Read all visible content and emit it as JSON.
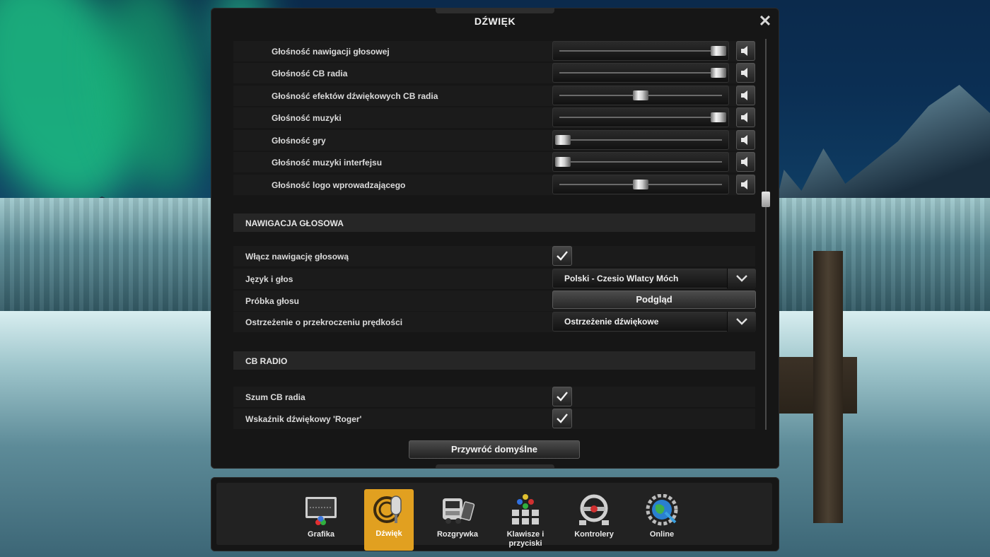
{
  "window": {
    "title": "DŹWIĘK",
    "close_label": "✕"
  },
  "volume_sliders": [
    {
      "label": "Głośność nawigacji głosowej",
      "value": 0.94
    },
    {
      "label": "Głośność CB radia",
      "value": 0.94
    },
    {
      "label": "Głośność efektów dźwiękowych CB radia",
      "value": 0.5
    },
    {
      "label": "Głośność muzyki",
      "value": 0.94
    },
    {
      "label": "Głośność gry",
      "value": 0.06
    },
    {
      "label": "Głośność muzyki interfejsu",
      "value": 0.06
    },
    {
      "label": "Głośność logo wprowadzającego",
      "value": 0.5
    }
  ],
  "voice_navigation": {
    "section_title": "NAWIGACJA GŁOSOWA",
    "enable_label": "Włącz nawigację głosową",
    "enable_checked": true,
    "language_label": "Język i głos",
    "language_value": "Polski - Czesio Wlatcy Móch",
    "sample_label": "Próbka głosu",
    "preview_button": "Podgląd",
    "speed_warning_label": "Ostrzeżenie o przekroczeniu prędkości",
    "speed_warning_value": "Ostrzeżenie dźwiękowe"
  },
  "cb_radio": {
    "section_title": "CB RADIO",
    "noise_label": "Szum CB radia",
    "noise_checked": true,
    "roger_label": "Wskaźnik dźwiękowy 'Roger'",
    "roger_checked": true
  },
  "reset_button": "Przywróć domyślne",
  "tabs": [
    {
      "label": "Grafika",
      "icon": "monitor-icon",
      "active": false
    },
    {
      "label": "Dźwięk",
      "icon": "microphone-icon",
      "active": true
    },
    {
      "label": "Rozgrywka",
      "icon": "truck-icon",
      "active": false
    },
    {
      "label": "Klawisze i przyciski",
      "icon": "keyboard-icon",
      "active": false
    },
    {
      "label": "Kontrolery",
      "icon": "steering-wheel-icon",
      "active": false
    },
    {
      "label": "Online",
      "icon": "globe-gear-icon",
      "active": false
    }
  ],
  "colors": {
    "active_tab": "#e1a020",
    "panel": "#161616",
    "row": "#1b1b1b"
  }
}
